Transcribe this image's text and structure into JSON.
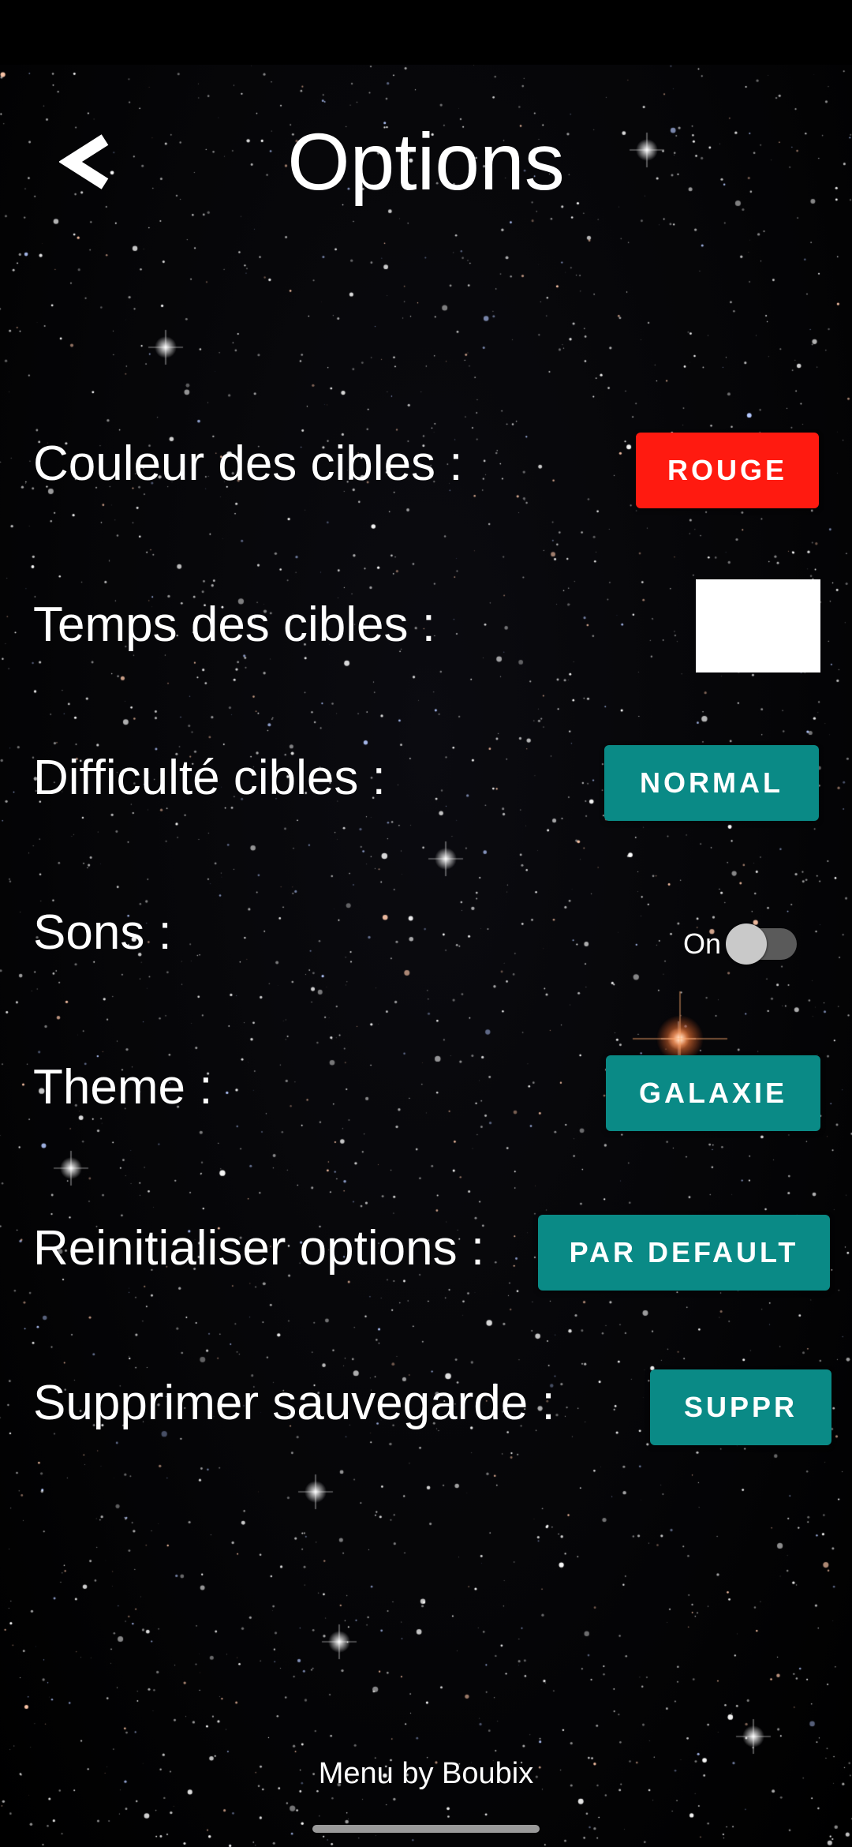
{
  "header": {
    "title": "Options",
    "back_icon": "chevron-left-icon"
  },
  "settings": {
    "target_color": {
      "label": "Couleur des cibles :",
      "button": "ROUGE",
      "color": "#ff1a10"
    },
    "target_time": {
      "label": "Temps des cibles :"
    },
    "target_difficulty": {
      "label": "Difficulté cibles :",
      "button": "NORMAL",
      "color": "#0a8a86"
    },
    "sounds": {
      "label": "Sons :",
      "toggle_text": "On",
      "enabled": false
    },
    "theme": {
      "label": "Theme :",
      "button": "GALAXIE",
      "color": "#0a8a86"
    },
    "reset": {
      "label": "Reinitialiser options :",
      "button": "PAR DEFAULT",
      "color": "#0a8a86"
    },
    "delete_save": {
      "label": "Supprimer sauvegarde :",
      "button": "SUPPR",
      "color": "#0a8a86"
    }
  },
  "footer": {
    "credit": "Menu by Boubix"
  }
}
